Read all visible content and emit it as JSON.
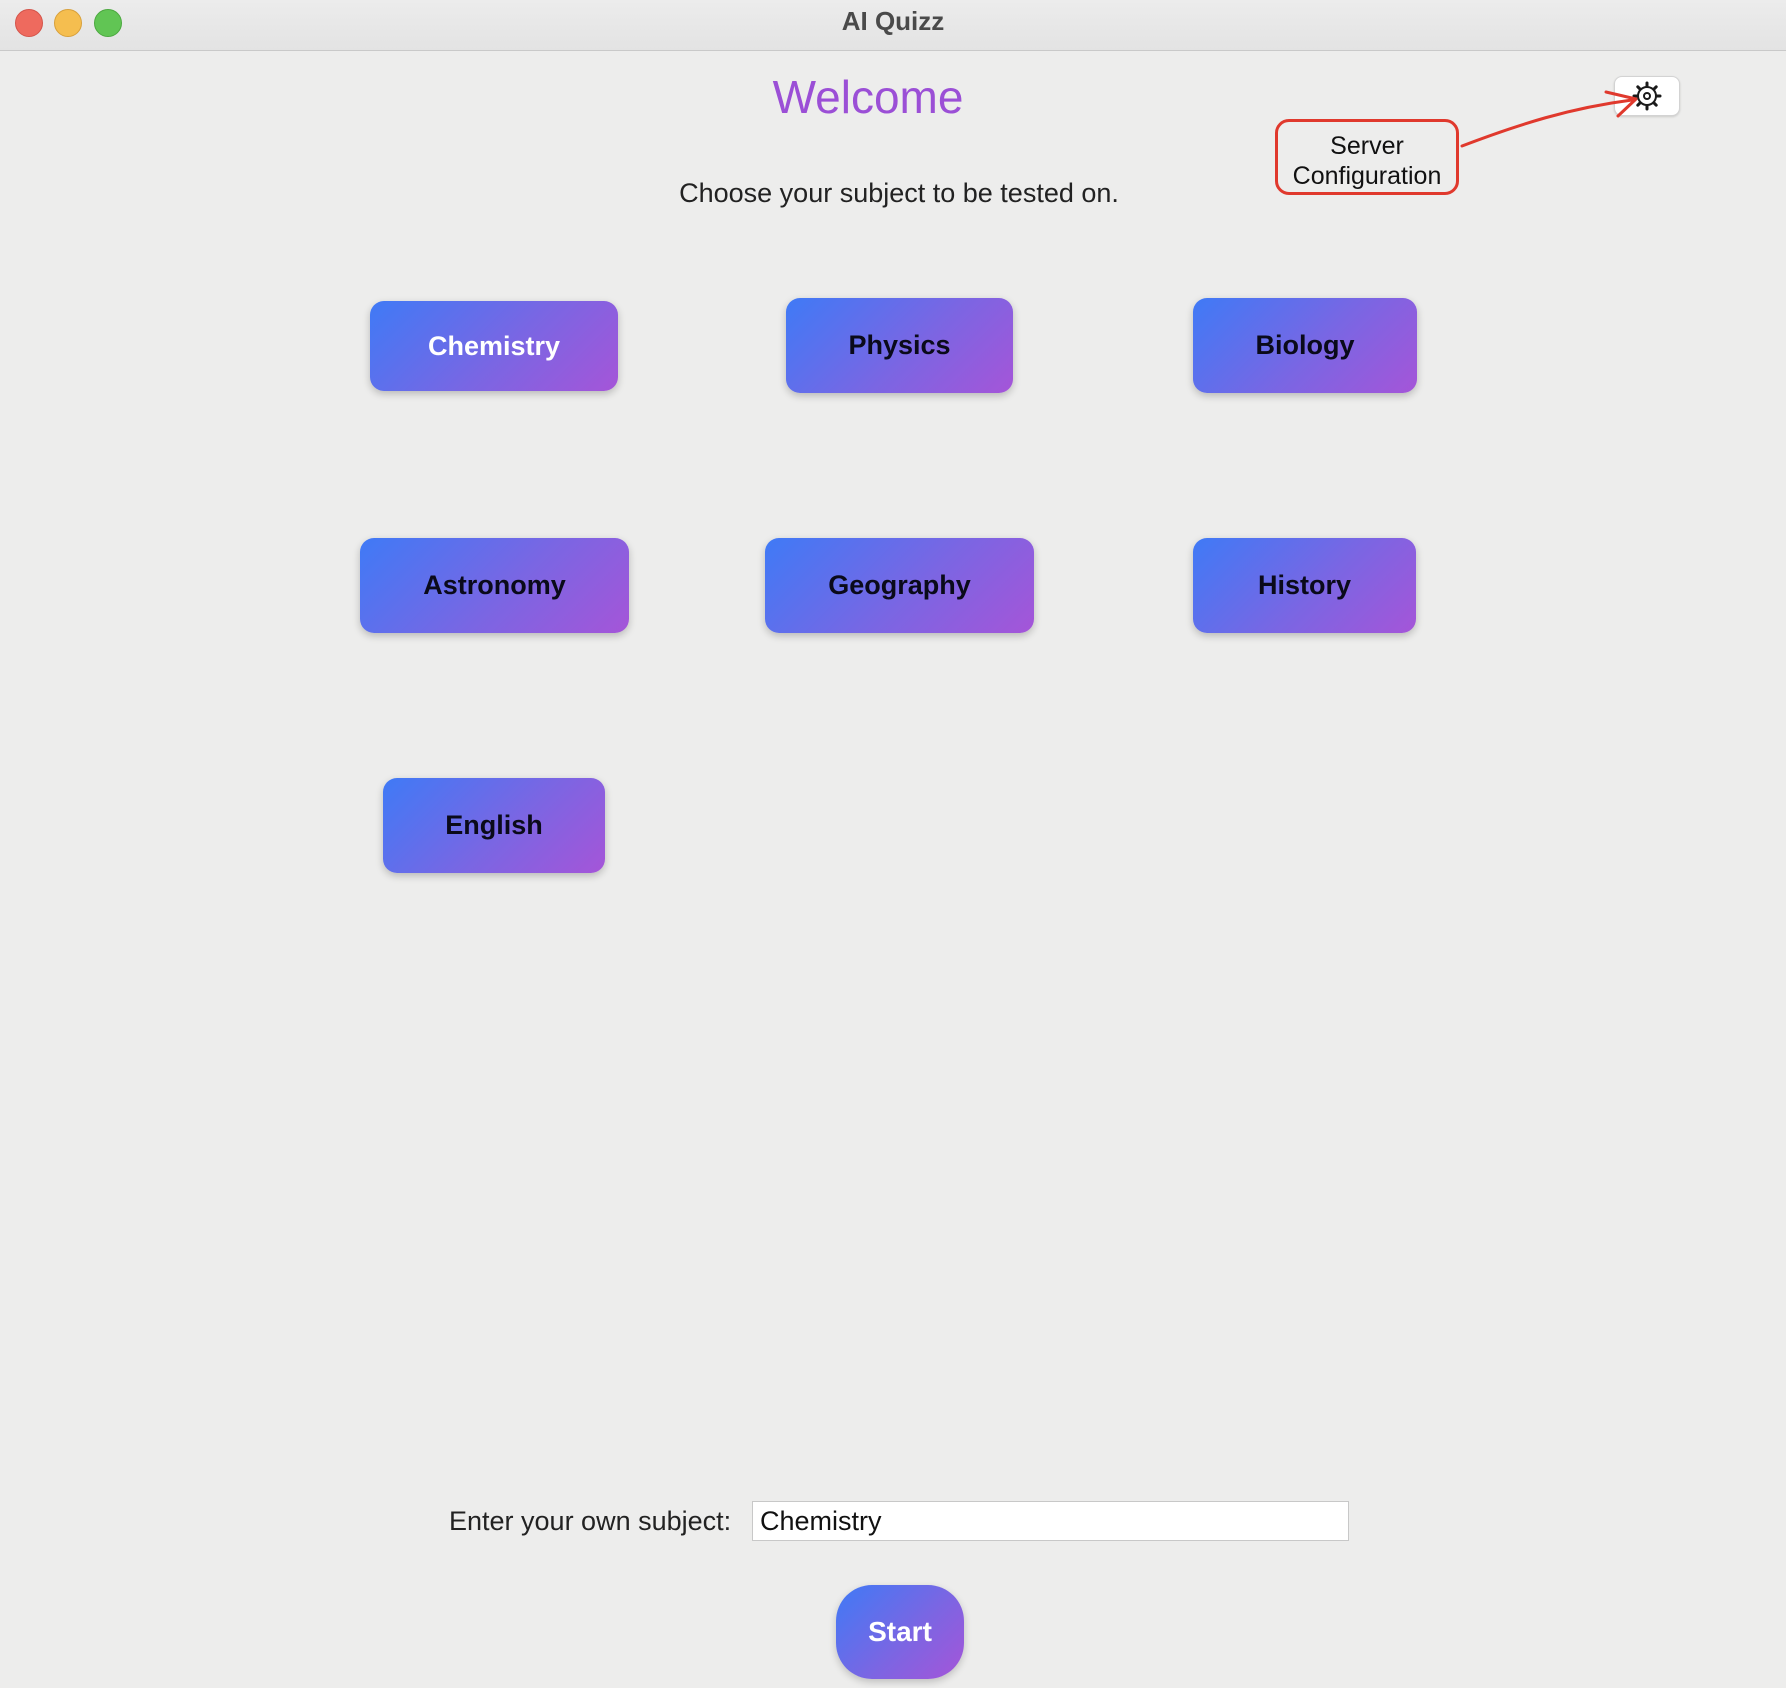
{
  "window": {
    "title": "AI Quizz"
  },
  "header": {
    "welcome": "Welcome",
    "subtitle": "Choose your subject to be tested on."
  },
  "settings": {
    "icon": "gear-icon",
    "callout": [
      "Server",
      "Configuration"
    ]
  },
  "subjects": [
    {
      "label": "Chemistry",
      "selected": true
    },
    {
      "label": "Physics",
      "selected": false
    },
    {
      "label": "Biology",
      "selected": false
    },
    {
      "label": "Astronomy",
      "selected": false
    },
    {
      "label": "Geography",
      "selected": false
    },
    {
      "label": "History",
      "selected": false
    },
    {
      "label": "English",
      "selected": false
    }
  ],
  "custom_subject": {
    "label": "Enter your own subject:",
    "value": "Chemistry"
  },
  "start": {
    "label": "Start"
  },
  "colors": {
    "accent": "#9b4fd6",
    "gradient_start": "#3f7af6",
    "gradient_end": "#a555d8",
    "annotation": "#e0392d"
  }
}
